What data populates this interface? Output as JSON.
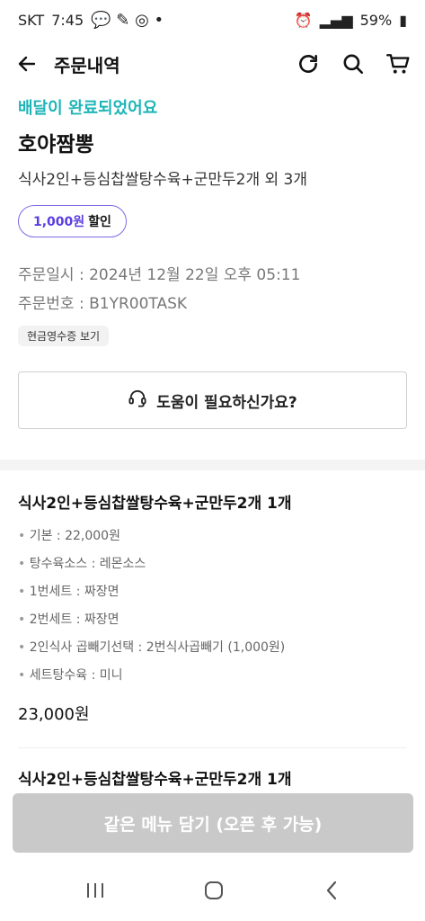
{
  "status_bar": {
    "carrier": "SKT",
    "time": "7:45",
    "battery": "59%"
  },
  "header": {
    "title": "주문내역",
    "icons": [
      "back-arrow-icon",
      "refresh-icon",
      "search-icon",
      "cart-icon"
    ]
  },
  "order": {
    "delivery_status": "배달이 완료되었어요",
    "store_name": "호야짬뽕",
    "summary": "식사2인+등심찹쌀탕수육+군만두2개 외 3개",
    "discount_amount": "1,000원",
    "discount_label": "할인",
    "order_date": "주문일시 : 2024년 12월 22일 오후 05:11",
    "order_number": "주문번호 : B1YR00TASK",
    "receipt_button": "현금영수증 보기",
    "help_button": "도움이 필요하신가요?"
  },
  "items": [
    {
      "name": "식사2인+등심찹쌀탕수육+군만두2개 1개",
      "options": [
        "기본 : 22,000원",
        "탕수육소스 : 레몬소스",
        "1번세트 : 짜장면",
        "2번세트 : 짜장면",
        "2인식사 곱빼기선택 : 2번식사곱빼기 (1,000원)",
        "세트탕수육 : 미니"
      ],
      "price": "23,000원"
    },
    {
      "name": "식사2인+등심찹쌀탕수육+군만두2개 1개"
    }
  ],
  "bottom_button": "같은 메뉴 담기 (오픈 후 가능)",
  "colors": {
    "accent_teal": "#1fb5b8",
    "discount_purple": "#5b3de0",
    "disabled_button": "#c9c9c9"
  }
}
